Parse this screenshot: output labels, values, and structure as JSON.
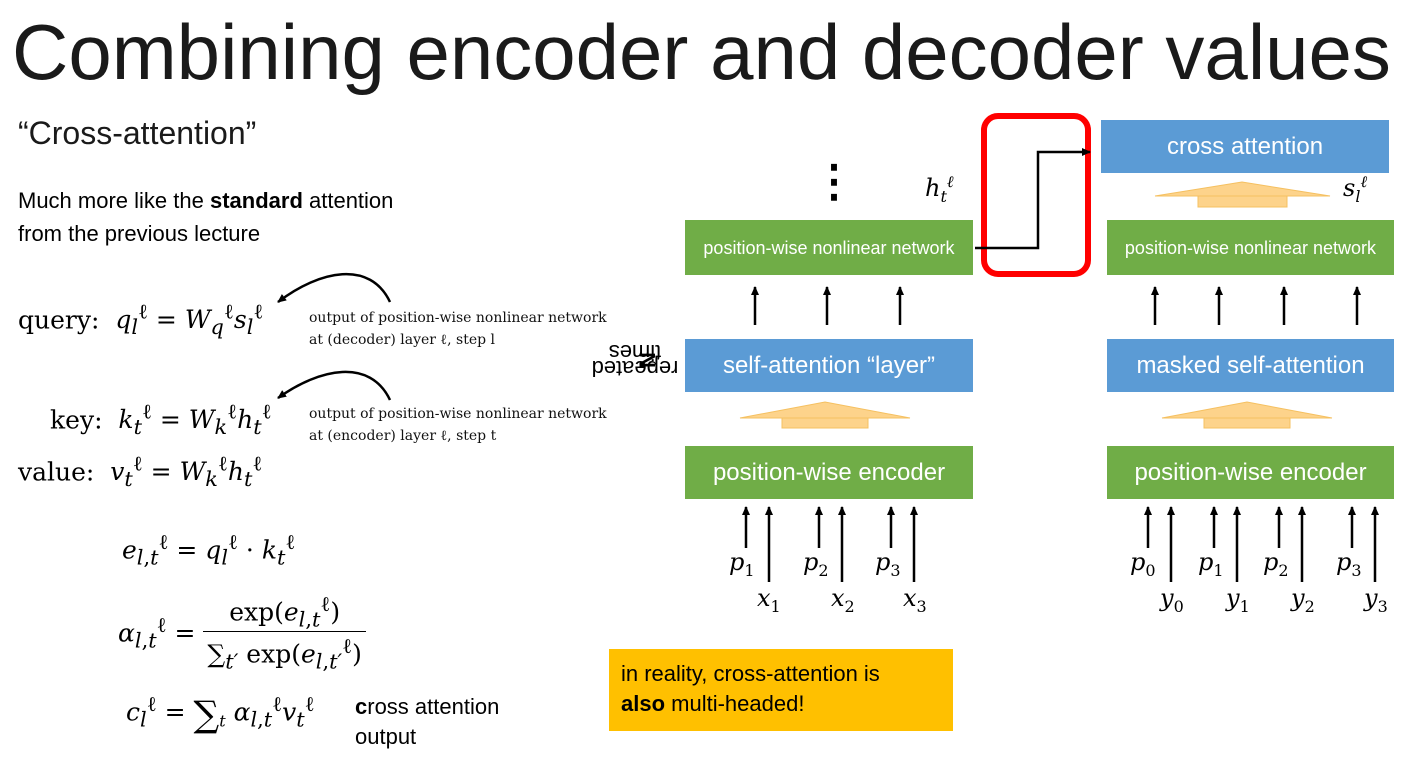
{
  "title": "Combining encoder and decoder values",
  "subtitle": "“Cross-attention”",
  "description": {
    "line1_pre": "Much more like the ",
    "line1_bold": "standard",
    "line1_post": " attention",
    "line2": "from the previous lecture"
  },
  "equations": {
    "query_label": "query:",
    "key_label": "key:",
    "value_label": "value:"
  },
  "notes": {
    "query_line1": "output of position-wise nonlinear network",
    "query_line2": "at (decoder) layer ℓ, step l",
    "key_line1": "output of position-wise nonlinear network",
    "key_line2": "at (encoder) layer ℓ, step t"
  },
  "cross_output": {
    "bold": "c",
    "rest": "ross attention",
    "line2": "output"
  },
  "encoder": {
    "nonlinear_label": "position-wise nonlinear network",
    "self_attention_label": "self-attention “layer”",
    "pos_encoder_label": "position-wise encoder",
    "ellipsis": "⋮",
    "repeated_pre": "repeated ",
    "repeated_bold": "N",
    "repeated_post": " times",
    "positions": [
      "p",
      "p",
      "p"
    ],
    "position_subs": [
      "1",
      "2",
      "3"
    ],
    "tokens": [
      "x",
      "x",
      "x"
    ],
    "token_subs": [
      "1",
      "2",
      "3"
    ]
  },
  "decoder": {
    "cross_attention_label": "cross attention",
    "nonlinear_label": "position-wise nonlinear network",
    "masked_label": "masked self-attention",
    "pos_encoder_label": "position-wise encoder",
    "positions": [
      "p",
      "p",
      "p",
      "p"
    ],
    "position_subs": [
      "0",
      "1",
      "2",
      "3"
    ],
    "tokens": [
      "y",
      "y",
      "y",
      "y"
    ],
    "token_subs": [
      "0",
      "1",
      "2",
      "3"
    ]
  },
  "callout": {
    "line1": "in reality, cross-attention is",
    "bold": "also",
    "rest": " multi-headed!"
  },
  "colors": {
    "green": "#70ad47",
    "blue": "#5b9bd5",
    "orange": "#ffc000",
    "red": "#ff0000",
    "up_arrow": "#fdd38b"
  }
}
